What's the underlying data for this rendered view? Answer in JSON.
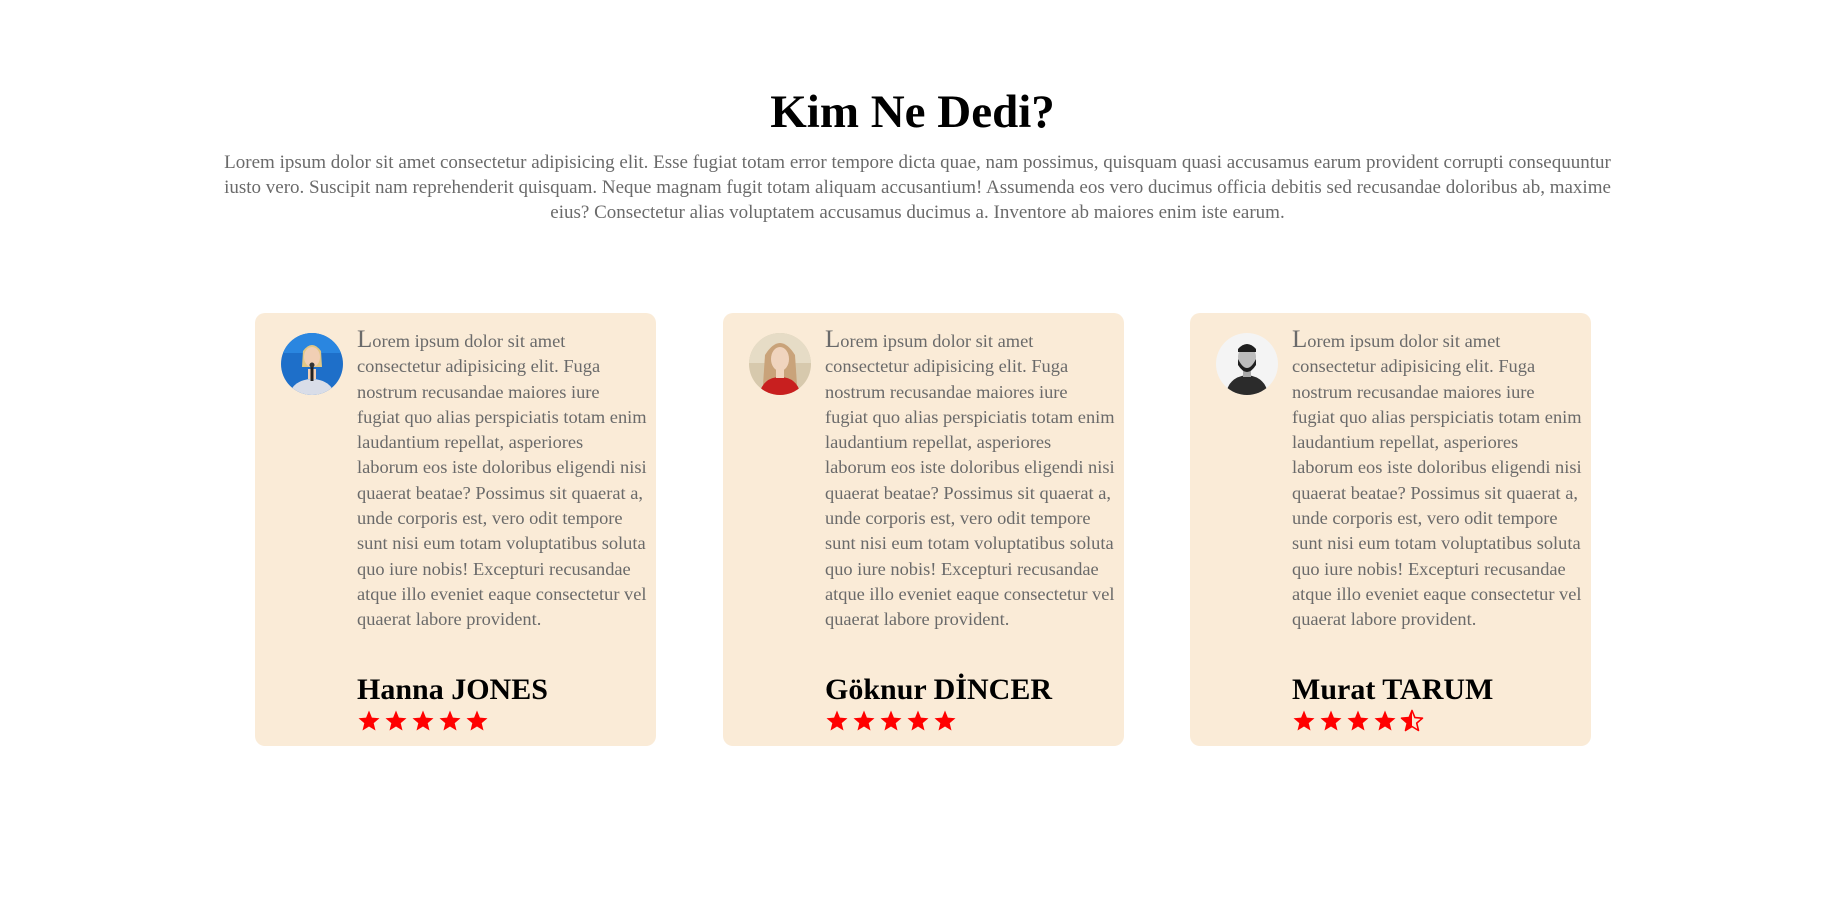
{
  "section": {
    "title": "Kim Ne Dedi?",
    "intro": "Lorem ipsum dolor sit amet consectetur adipisicing elit. Esse fugiat totam error tempore dicta quae, nam possimus, quisquam quasi accusamus earum provident corrupti consequuntur iusto vero. Suscipit nam reprehenderit quisquam. Neque magnam fugit totam aliquam accusantium! Assumenda eos vero ducimus officia debitis sed recusandae doloribus ab, maxime eius? Consectetur alias voluptatem accusamus ducimus a. Inventore ab maiores enim iste earum."
  },
  "colors": {
    "card_background": "#faebd7",
    "star": "#ff0000",
    "heading": "#000000",
    "body_text": "#6a6a6a"
  },
  "testimonials": [
    {
      "avatar_icon": "woman-speaker-avatar",
      "quote": "Lorem ipsum dolor sit amet consectetur adipisicing elit. Fuga nostrum recusandae maiores iure fugiat quo alias perspiciatis totam enim laudantium repellat, asperiores laborum eos iste doloribus eligendi nisi quaerat beatae? Possimus sit quaerat a, unde corporis est, vero odit tempore sunt nisi eum totam voluptatibus soluta quo iure nobis! Excepturi recusandae atque illo eveniet eaque consectetur vel quaerat labore provident.",
      "name": "Hanna JONES",
      "rating": 5
    },
    {
      "avatar_icon": "woman-portrait-avatar",
      "quote": "Lorem ipsum dolor sit amet consectetur adipisicing elit. Fuga nostrum recusandae maiores iure fugiat quo alias perspiciatis totam enim laudantium repellat, asperiores laborum eos iste doloribus eligendi nisi quaerat beatae? Possimus sit quaerat a, unde corporis est, vero odit tempore sunt nisi eum totam voluptatibus soluta quo iure nobis! Excepturi recusandae atque illo eveniet eaque consectetur vel quaerat labore provident.",
      "name": "Göknur DİNCER",
      "rating": 5
    },
    {
      "avatar_icon": "bearded-man-avatar",
      "quote": "Lorem ipsum dolor sit amet consectetur adipisicing elit. Fuga nostrum recusandae maiores iure fugiat quo alias perspiciatis totam enim laudantium repellat, asperiores laborum eos iste doloribus eligendi nisi quaerat beatae? Possimus sit quaerat a, unde corporis est, vero odit tempore sunt nisi eum totam voluptatibus soluta quo iure nobis! Excepturi recusandae atque illo eveniet eaque consectetur vel quaerat labore provident.",
      "name": "Murat TARUM",
      "rating": 4.5
    }
  ]
}
